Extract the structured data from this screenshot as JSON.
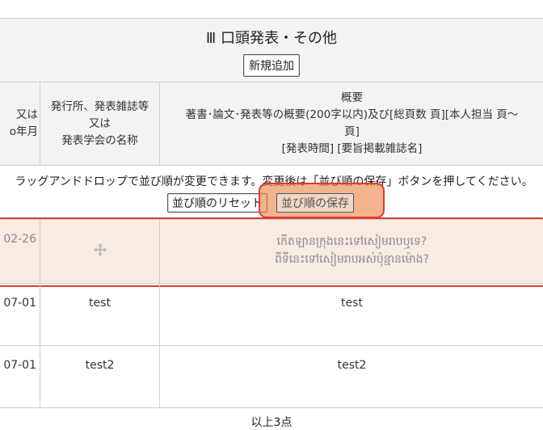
{
  "section": {
    "title": "Ⅲ 口頭発表・その他",
    "add_button": "新規追加"
  },
  "columns": {
    "date": [
      "又は",
      "o年月"
    ],
    "publisher": [
      "発行所、発表雑誌等",
      "又は",
      "発表学会の名称"
    ],
    "summary": [
      "概要",
      "著書･論文･発表等の概要(200字以内)及び[総頁数 頁][本人担当 頁～",
      "頁]",
      "[発表時間] [要旨掲載雑誌名]"
    ]
  },
  "sort": {
    "note": "ラッグアンドドロップで並び順が変更できます。変更後は「並び順の保存」ボタンを押してください。",
    "reset_button": "並び順のリセット",
    "save_button": "並び順の保存"
  },
  "rows": [
    {
      "date": "02-26",
      "publisher": "",
      "summary_lines": [
        "កើតឡានក្រុងនេះទៅសៀមរាបឬទេ?",
        "ពីទីនេះទៅសៀមរាបអស់ប៉ុន្មានម៉ោង?"
      ]
    },
    {
      "date": "07-01",
      "publisher": "test",
      "summary_lines": [
        "test"
      ]
    },
    {
      "date": "07-01",
      "publisher": "test2",
      "summary_lines": [
        "test2"
      ]
    }
  ],
  "icons": {
    "drag_handle": "move-arrows-icon"
  },
  "colors": {
    "highlight": "#e03a30",
    "highlight_fill": "#ec8c50",
    "dragged_row": "#f7ebe2"
  },
  "footer": {
    "count": "以上3点"
  }
}
